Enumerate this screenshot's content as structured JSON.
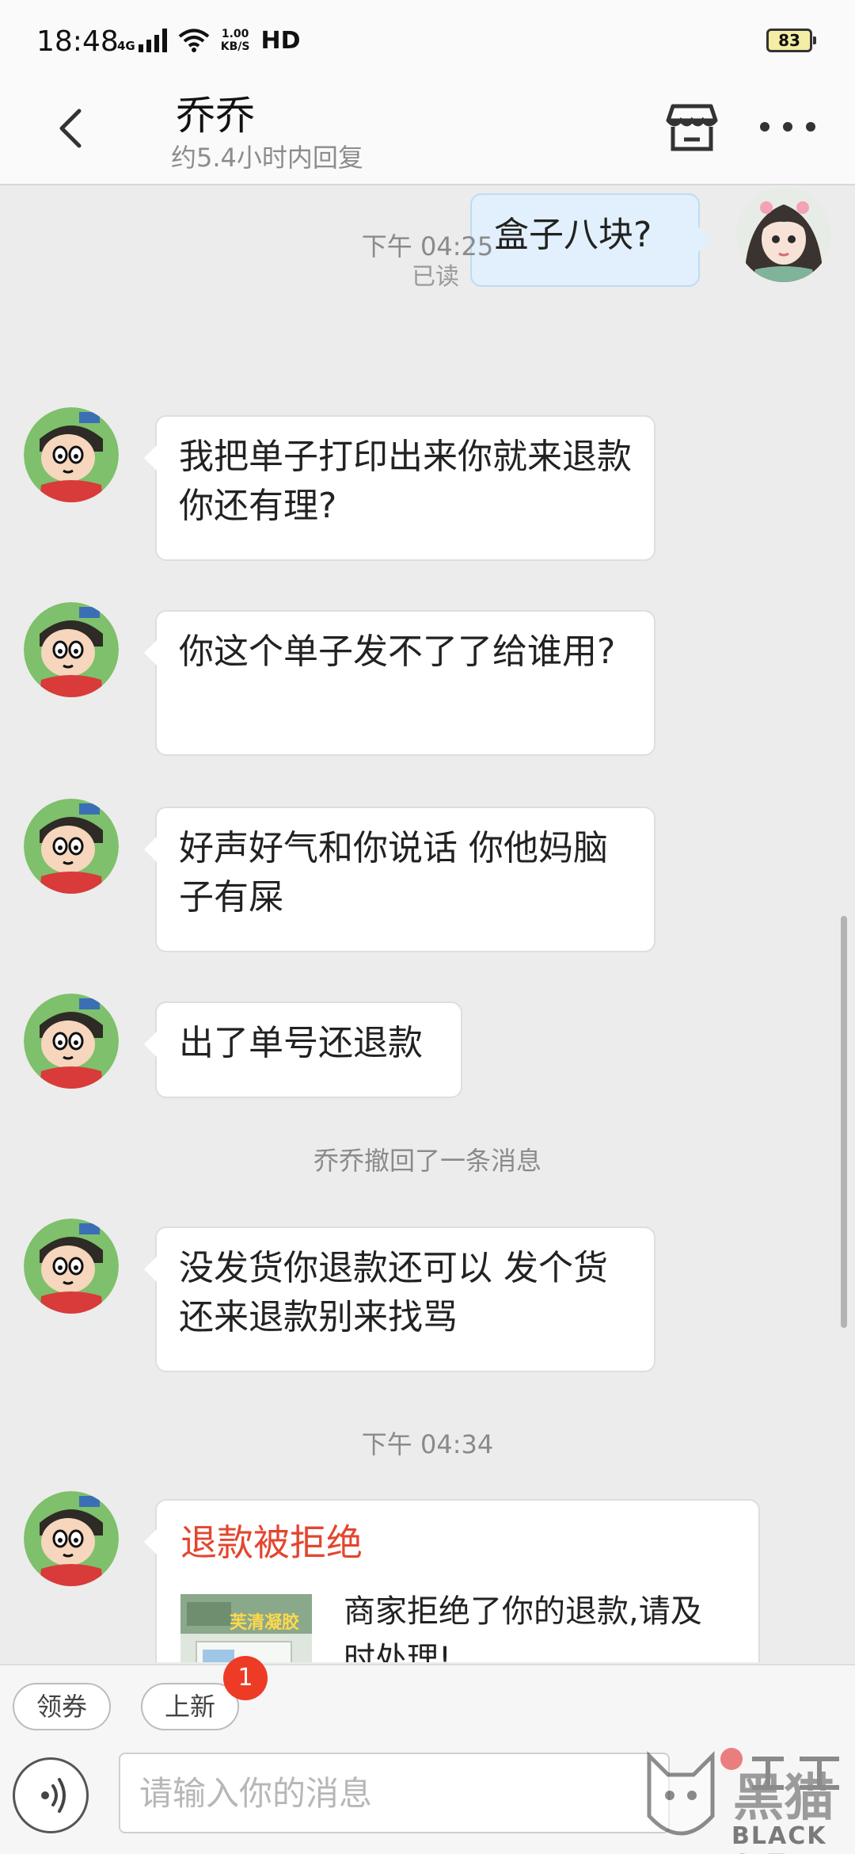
{
  "status_bar": {
    "time": "18:48",
    "network": "4G",
    "speed_value": "1.00",
    "speed_unit": "KB/S",
    "hd": "HD",
    "battery": "83"
  },
  "header": {
    "title": "乔乔",
    "subtitle": "约5.4小时内回复"
  },
  "messages": {
    "sent_1": "盒子八块?",
    "read_label": "已读",
    "time_1": "下午 04:25",
    "received_1": "我把单子打印出来你就来退款你还有理?",
    "received_2": "你这个单子发不了了给谁用?",
    "received_3": "好声好气和你说话 你他妈脑子有屎",
    "received_4": "出了单号还退款",
    "recall_note": "乔乔撤回了一条消息",
    "received_5": "没发货你退款还可以 发个货还来退款别来找骂",
    "time_2": "下午 04:34",
    "refund_card": {
      "title": "退款被拒绝",
      "description": "商家拒绝了你的退款,请及时处理!",
      "thumb_text": "芙清凝胶"
    }
  },
  "quick_bar": {
    "coupon_label": "领券",
    "new_label": "上新",
    "new_badge": "1"
  },
  "input": {
    "placeholder": "请输入你的消息"
  },
  "watermark": {
    "text": "BLACK CAT",
    "logo_text": "黑猫"
  },
  "colors": {
    "accent_red": "#e3462f",
    "badge_red": "#ee3b25",
    "sent_bubble": "#e1f0fc",
    "background": "#ececec"
  }
}
